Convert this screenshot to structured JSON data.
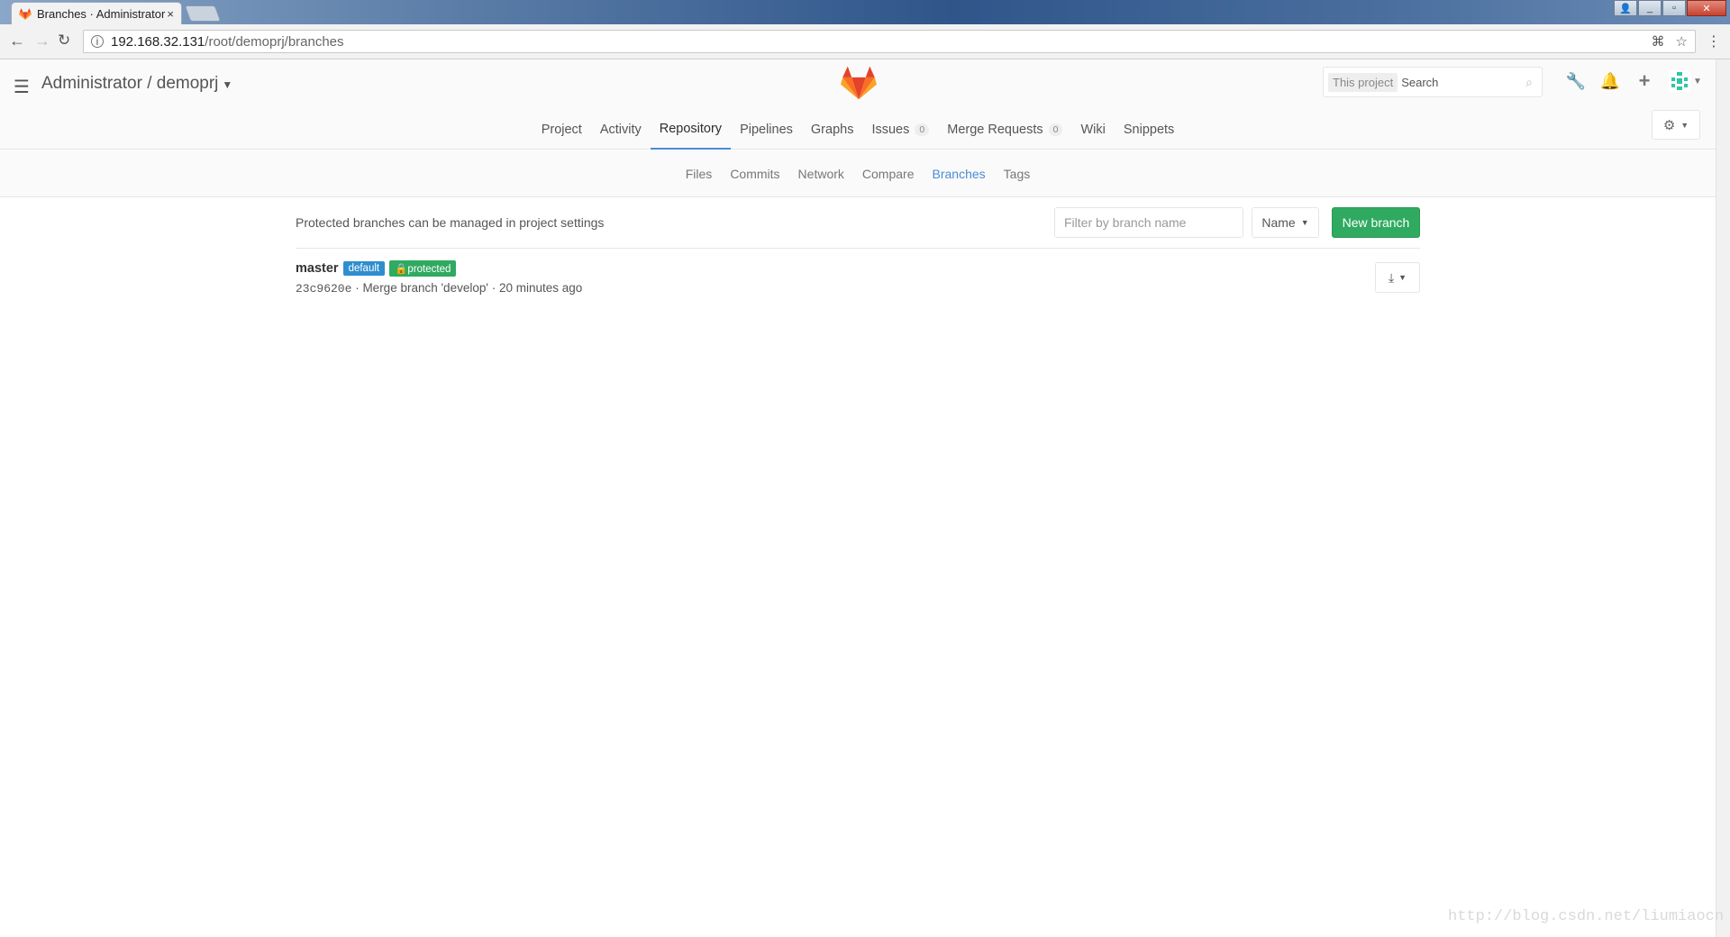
{
  "browser": {
    "tab_title": "Branches · Administrator",
    "tab_close": "×",
    "url_host": "192.168.32.131",
    "url_path": "/root/demoprj/branches",
    "window_buttons": [
      "_",
      "▫",
      "✕"
    ]
  },
  "header": {
    "project_title": "Administrator / demoprj",
    "search_scope": "This project",
    "search_placeholder": "Search",
    "brand_color": "#e24329"
  },
  "nav": {
    "items": [
      {
        "label": "Project"
      },
      {
        "label": "Activity"
      },
      {
        "label": "Repository",
        "active": true
      },
      {
        "label": "Pipelines"
      },
      {
        "label": "Graphs"
      },
      {
        "label": "Issues",
        "count": "0"
      },
      {
        "label": "Merge Requests",
        "count": "0"
      },
      {
        "label": "Wiki"
      },
      {
        "label": "Snippets"
      }
    ]
  },
  "subnav": {
    "items": [
      {
        "label": "Files"
      },
      {
        "label": "Commits"
      },
      {
        "label": "Network"
      },
      {
        "label": "Compare"
      },
      {
        "label": "Branches",
        "active": true
      },
      {
        "label": "Tags"
      }
    ]
  },
  "branches": {
    "protected_note": "Protected branches can be managed in project settings",
    "filter_placeholder": "Filter by branch name",
    "sort_label": "Name",
    "new_branch_label": "New branch",
    "list": [
      {
        "name": "master",
        "labels": [
          "default",
          "protected"
        ],
        "commit_sha": "23c9620e",
        "commit_message": "Merge branch 'develop'",
        "commit_time": "20 minutes ago"
      }
    ]
  },
  "watermark": "http://blog.csdn.net/liumiaocn",
  "colors": {
    "accent": "#4a8bd6",
    "success": "#2faa60",
    "info": "#2f8ece"
  }
}
